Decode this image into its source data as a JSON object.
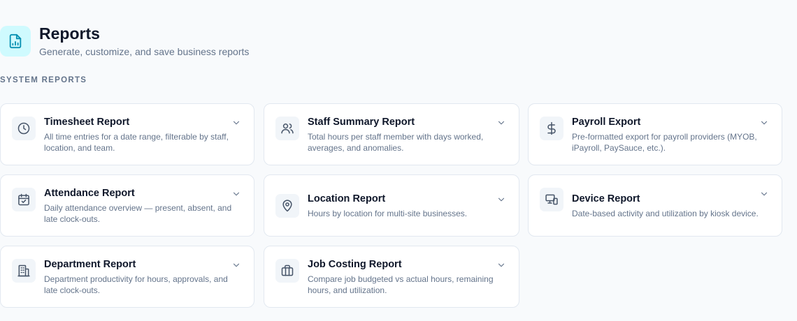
{
  "header": {
    "title": "Reports",
    "subtitle": "Generate, customize, and save business reports",
    "icon": "report-chart-icon"
  },
  "section": {
    "label": "SYSTEM REPORTS"
  },
  "colors": {
    "accent": "#0891b2",
    "accent_bg": "#cffafe",
    "icon_stroke": "#475569"
  },
  "reports": [
    {
      "title": "Timesheet Report",
      "description": "All time entries for a date range, filterable by staff, location, and team.",
      "icon": "clock-icon"
    },
    {
      "title": "Staff Summary Report",
      "description": "Total hours per staff member with days worked, averages, and anomalies.",
      "icon": "users-icon"
    },
    {
      "title": "Payroll Export",
      "description": "Pre-formatted export for payroll providers (MYOB, iPayroll, PaySauce, etc.).",
      "icon": "dollar-icon"
    },
    {
      "title": "Attendance Report",
      "description": "Daily attendance overview — present, absent, and late clock-outs.",
      "icon": "calendar-check-icon"
    },
    {
      "title": "Location Report",
      "description": "Hours by location for multi-site businesses.",
      "icon": "map-pin-icon"
    },
    {
      "title": "Device Report",
      "description": "Date-based activity and utilization by kiosk device.",
      "icon": "devices-icon"
    },
    {
      "title": "Department Report",
      "description": "Department productivity for hours, approvals, and late clock-outs.",
      "icon": "building-icon"
    },
    {
      "title": "Job Costing Report",
      "description": "Compare job budgeted vs actual hours, remaining hours, and utilization.",
      "icon": "briefcase-icon"
    }
  ]
}
